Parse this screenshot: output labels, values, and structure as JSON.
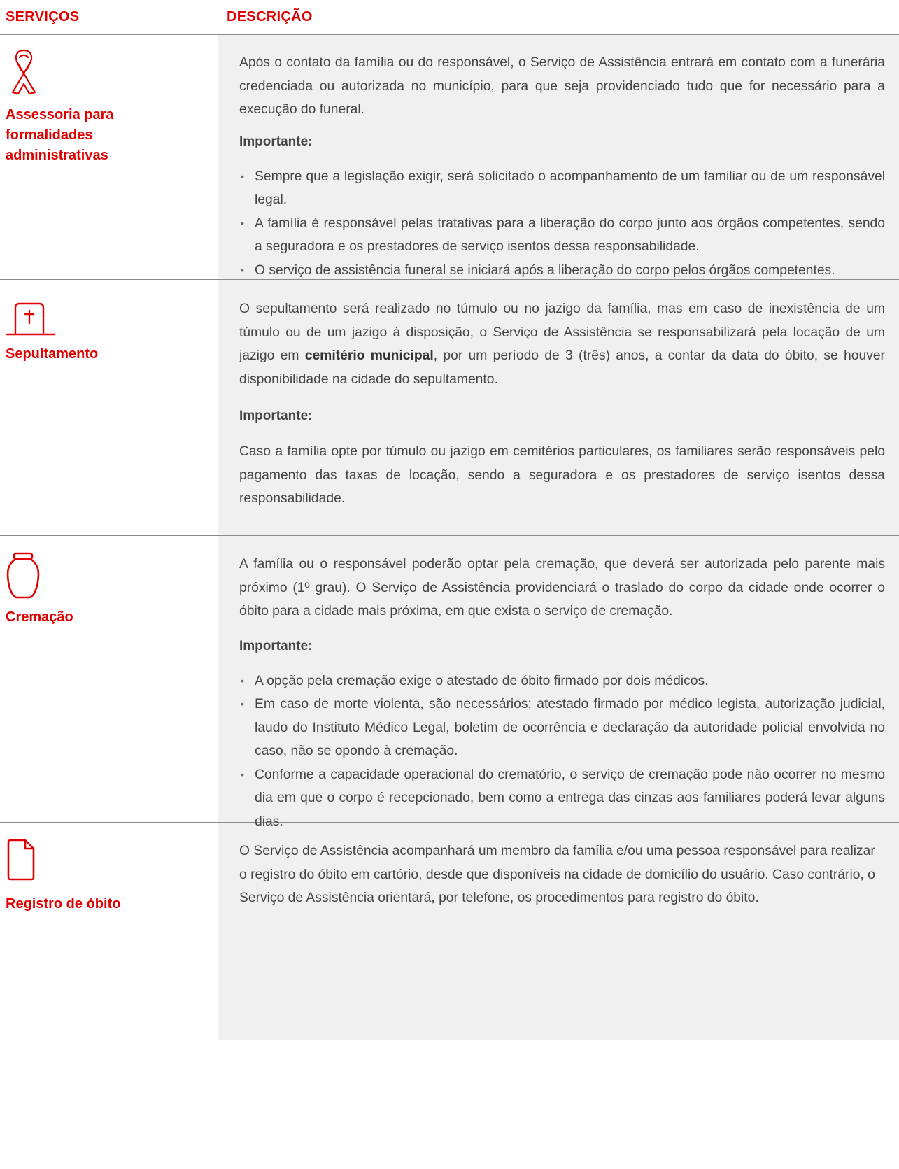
{
  "header": {
    "col_services": "SERVIÇOS",
    "col_description": "DESCRIÇÃO"
  },
  "colors": {
    "accent": "#e00000",
    "panel": "#f0f0f0",
    "divider": "#8a8a8a"
  },
  "rows": [
    {
      "icon": "ribbon-icon",
      "name": "Assessoria para formalidades administrativas",
      "description": "Após o contato da família ou do responsável, o Serviço de Assistência entrará em contato com a funerária credenciada ou autorizada no município, para que seja providenciado tudo que for necessário para a execução do funeral.",
      "important_label": "Importante:",
      "bullets": [
        "Sempre que a legislação exigir, será solicitado o acompanhamento de um familiar ou de um responsável legal.",
        "A família é responsável pelas tratativas para a liberação do corpo junto aos órgãos competentes, sendo a seguradora e os prestadores de serviço isentos dessa responsabilidade.",
        "O serviço de assistência funeral se iniciará após a liberação do corpo pelos órgãos competentes."
      ]
    },
    {
      "icon": "tombstone-icon",
      "name": "Sepultamento",
      "description_part1": "O sepultamento será realizado no túmulo ou no jazigo da família, mas em caso de inexistência de um túmulo ou de um jazigo à disposição, o Serviço de Assistência se responsabilizará pela locação de um jazigo em ",
      "description_bold": "cemitério municipal",
      "description_part2": ", por um período de 3 (três) anos, a contar da data do óbito, se houver disponibilidade na cidade do sepultamento.",
      "important_label": "Importante:",
      "important_text": "Caso a família opte por túmulo ou jazigo em cemitérios particulares, os familiares serão responsáveis pelo pagamento das taxas de locação, sendo a seguradora e os prestadores de serviço isentos dessa responsabilidade."
    },
    {
      "icon": "urn-icon",
      "name": "Cremação",
      "description": "A família ou o responsável poderão optar pela cremação, que deverá ser autorizada pelo parente mais próximo (1º grau). O Serviço de Assistência providenciará o traslado do corpo da cidade onde ocorrer o óbito para a cidade mais próxima, em que exista o serviço de cremação.",
      "important_label": "Importante:",
      "bullets": [
        "A opção pela cremação exige o atestado de óbito firmado por dois médicos.",
        "Em caso de morte violenta, são necessários: atestado firmado por médico legista, autorização judicial, laudo do Instituto Médico Legal, boletim de ocorrência e declaração da autoridade policial envolvida no caso, não se opondo à cremação.",
        "Conforme a capacidade operacional do crematório, o serviço de cremação pode não ocorrer no mesmo dia em que o corpo é recepcionado, bem como a entrega das cinzas aos familiares poderá levar alguns dias."
      ]
    },
    {
      "icon": "document-icon",
      "name": "Registro de óbito",
      "description": "O Serviço de Assistência acompanhará um membro da família e/ou uma pessoa responsável para realizar o registro do óbito em cartório, desde que disponíveis na cidade de domicílio do usuário. Caso contrário, o Serviço de Assistência orientará, por telefone, os procedimentos para registro do óbito."
    }
  ]
}
